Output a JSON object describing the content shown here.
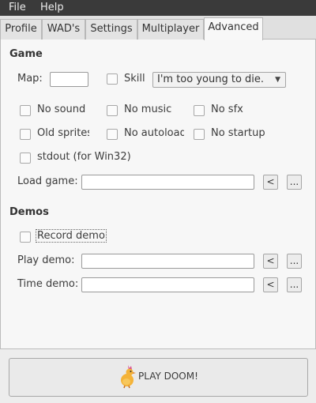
{
  "menubar": {
    "file": "File",
    "help": "Help"
  },
  "tabs": [
    "Profile",
    "WAD's",
    "Settings",
    "Multiplayer",
    "Advanced"
  ],
  "game": {
    "heading": "Game",
    "map_label": "Map:",
    "map_value": "",
    "skill_label": "Skill",
    "skill_value": "I'm too young to die.",
    "options": [
      "No sound",
      "No music",
      "No sfx",
      "Old sprites",
      "No autoload",
      "No startup",
      "stdout (for Win32)"
    ],
    "load_game_label": "Load game:",
    "load_game_value": ""
  },
  "demos": {
    "heading": "Demos",
    "record_label": "Record demo",
    "play_label": "Play demo:",
    "play_value": "",
    "time_label": "Time demo:",
    "time_value": ""
  },
  "buttons": {
    "prev": "<",
    "browse": "..."
  },
  "play_button": {
    "label": "PLAY DOOM!",
    "icon": "chicken-mascot-icon"
  },
  "colors": {
    "menubar": "#3a3a3a",
    "panel": "#f7f7f7",
    "window": "#ededed"
  }
}
